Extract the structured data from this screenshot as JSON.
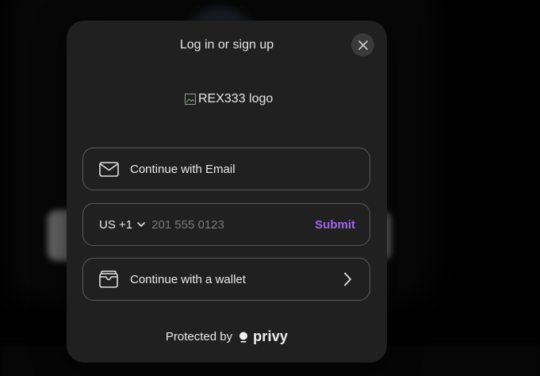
{
  "modal": {
    "title": "Log in or sign up",
    "close_icon": "close-icon",
    "logo_alt": "REX333 logo"
  },
  "options": {
    "email_label": "Continue with Email",
    "email_icon": "mail-icon",
    "phone": {
      "country_code": "US +1",
      "placeholder": "201 555 0123",
      "submit_label": "Submit"
    },
    "wallet_label": "Continue with a wallet",
    "wallet_icon": "wallet-icon"
  },
  "footer": {
    "protected_by": "Protected by",
    "brand": "privy"
  },
  "colors": {
    "accent": "#a066f0",
    "modal_bg": "#202020",
    "border": "#5a5a5a"
  }
}
